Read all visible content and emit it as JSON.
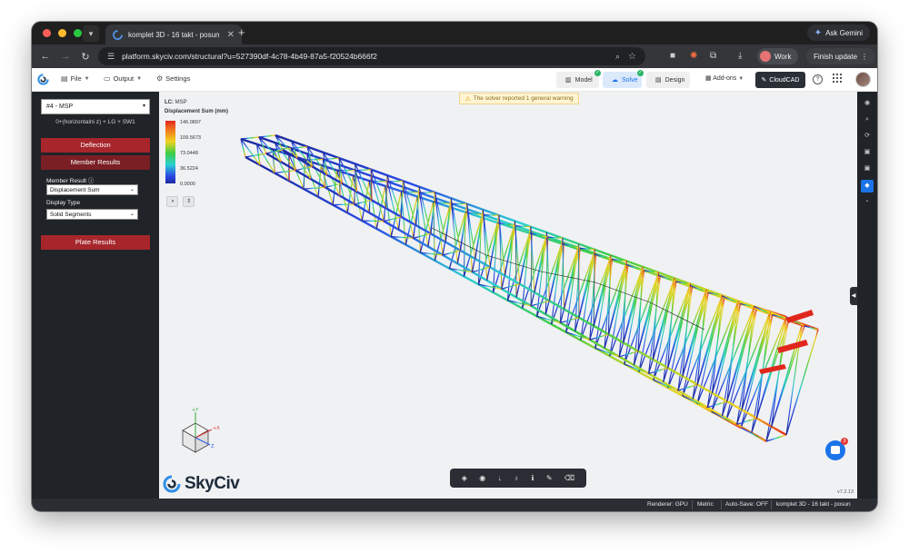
{
  "browser": {
    "tab_title": "komplet 3D - 16 takt - posun",
    "url": "platform.skyciv.com/structural?u=527390df-4c78-4b49-87a5-f20524b666f2",
    "ask_gemini": "Ask Gemini",
    "profile_label": "Work",
    "update_label": "Finish update"
  },
  "appbar": {
    "file": "File",
    "output": "Output",
    "settings": "Settings",
    "model": "Model",
    "solve": "Solve",
    "design": "Design",
    "addons": "Add-ons",
    "cloudcad": "CloudCAD"
  },
  "left_panel": {
    "load_case": "#4 - MSP",
    "combination": "0+(horizontalni z) + LG + SW1",
    "deflection": "Deflection",
    "member_results": "Member Results",
    "member_result_label": "Member Result",
    "member_result_value": "Displacement Sum",
    "display_type_label": "Display Type",
    "display_type_value": "Solid Segments",
    "plate_results": "Plate Results"
  },
  "viewport": {
    "lc_prefix": "LC:",
    "lc_value": "MSP",
    "legend_title": "Displacement Sum (mm)",
    "legend_ticks": [
      "146.0897",
      "109.5673",
      "73.0448",
      "36.5224",
      "0.0000"
    ],
    "warning": "The solver reported 1 general warning",
    "axis_labels": {
      "y": "+Y",
      "x": "+X",
      "z": "Z"
    },
    "brand": "SkyCiv",
    "version": "v7.2.13",
    "chat_badge": "3",
    "colors": {
      "max": "#e1261c",
      "high": "#f1d21f",
      "mid": "#3ccc45",
      "low": "#2bcfd1",
      "min": "#1a2a9c"
    }
  },
  "statusbar": {
    "renderer": "Renderer: GPU",
    "units": "Metric",
    "autosave": "Auto-Save: OFF",
    "project": "komplet 3D - 16 takt - posun"
  }
}
